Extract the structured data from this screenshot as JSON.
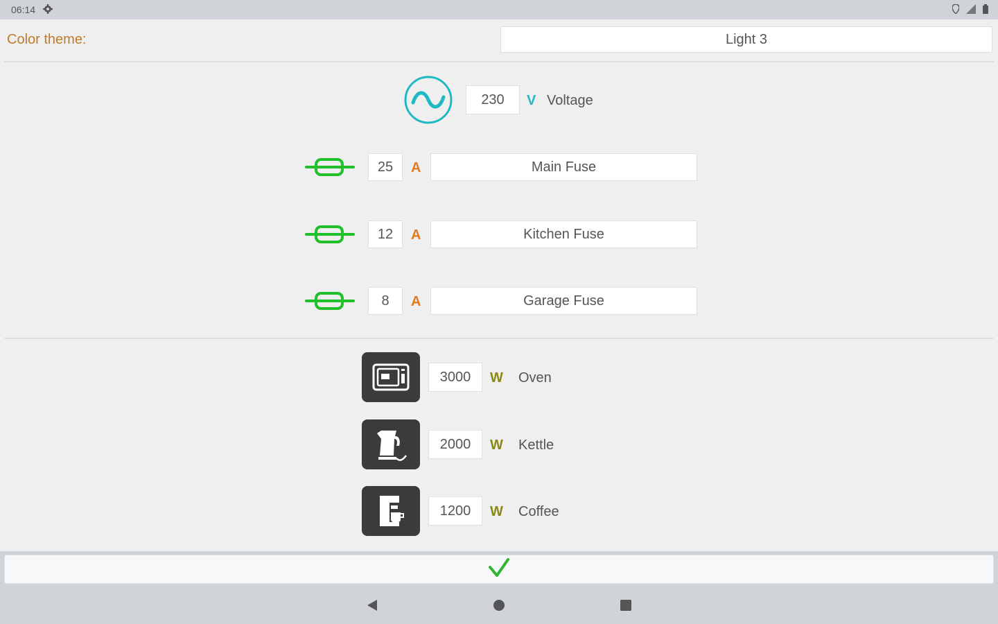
{
  "status_bar": {
    "time": "06:14"
  },
  "theme": {
    "label": "Color theme:",
    "value": "Light 3"
  },
  "voltage": {
    "value": "230",
    "unit": "V",
    "label": "Voltage"
  },
  "fuses": [
    {
      "amps": "25",
      "unit": "A",
      "name": "Main Fuse"
    },
    {
      "amps": "12",
      "unit": "A",
      "name": "Kitchen Fuse"
    },
    {
      "amps": "8",
      "unit": "A",
      "name": "Garage Fuse"
    }
  ],
  "appliances": [
    {
      "icon": "oven-icon",
      "watts": "3000",
      "unit": "W",
      "name": "Oven"
    },
    {
      "icon": "kettle-icon",
      "watts": "2000",
      "unit": "W",
      "name": "Kettle"
    },
    {
      "icon": "coffee-maker-icon",
      "watts": "1200",
      "unit": "W",
      "name": "Coffee"
    }
  ],
  "colors": {
    "accent_teal": "#1fb9c4",
    "fuse_green": "#22c02a",
    "amp_orange": "#e07b20",
    "watt_olive": "#8a8a10",
    "label_orange": "#c07a2a",
    "check_green": "#2fb52f"
  }
}
